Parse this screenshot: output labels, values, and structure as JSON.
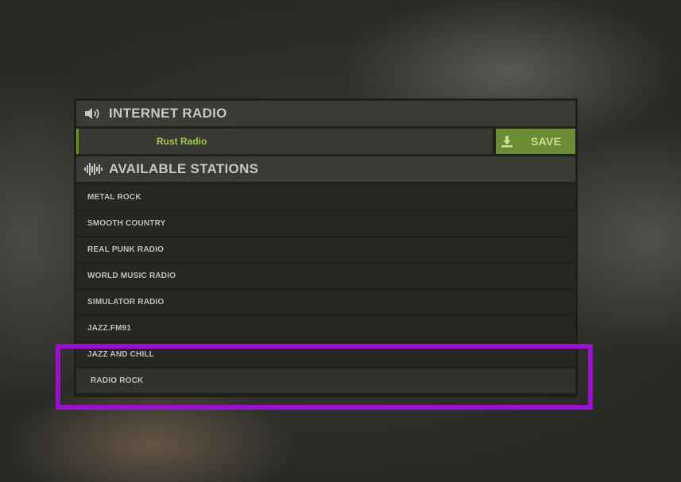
{
  "window": {
    "title": "INTERNET RADIO",
    "title_icon": "speaker-icon"
  },
  "url_input": {
    "value": "Rust Radio"
  },
  "save_button": {
    "label": "SAVE",
    "icon": "download-icon"
  },
  "stations_section": {
    "title": "AVAILABLE STATIONS",
    "icon": "waveform-icon"
  },
  "stations": [
    {
      "name": "METAL ROCK"
    },
    {
      "name": "SMOOTH COUNTRY"
    },
    {
      "name": "REAL PUNK RADIO"
    },
    {
      "name": "WORLD MUSIC RADIO"
    },
    {
      "name": "SIMULATOR RADIO"
    },
    {
      "name": "JAZZ.FM91"
    },
    {
      "name": "JAZZ AND CHILL"
    },
    {
      "name": "RADIO ROCK"
    }
  ],
  "colors": {
    "accent_green": "#6c8c33",
    "input_text": "#a6cb4a",
    "highlight": "#9b10cf"
  }
}
